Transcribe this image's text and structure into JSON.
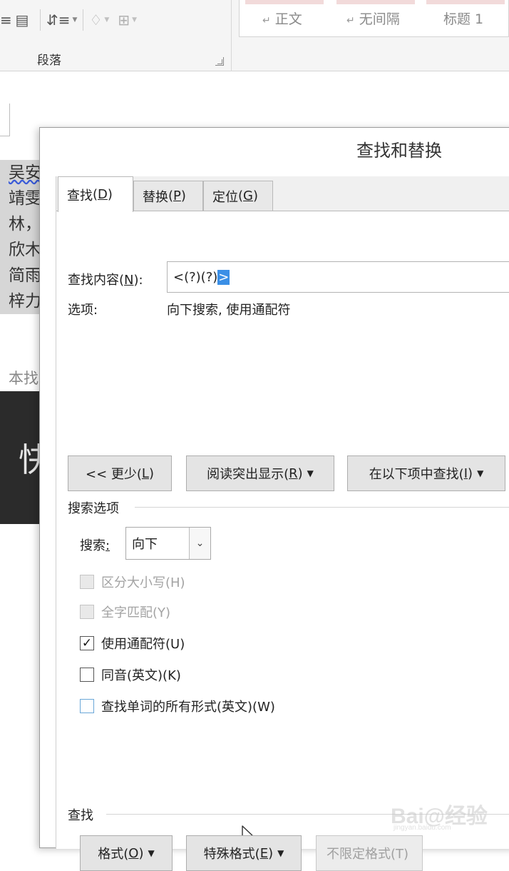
{
  "ribbon": {
    "paragraph_group_label": "段落",
    "styles": [
      "正文",
      "无间隔",
      "标题 1"
    ]
  },
  "document": {
    "lines": [
      "吴安",
      "靖雯",
      "林，",
      "欣木",
      "简雨",
      "梓力"
    ],
    "note": "本找",
    "dark_text": "快"
  },
  "dialog": {
    "title": "查找和替换",
    "tabs": [
      {
        "label": "查找",
        "accel": "D"
      },
      {
        "label": "替换",
        "accel": "P"
      },
      {
        "label": "定位",
        "accel": "G"
      }
    ],
    "find": {
      "label": "查找内容",
      "label_accel": "N",
      "value_prefix": "<(?)(?)",
      "value_selected": ">"
    },
    "options": {
      "label": "选项:",
      "value": "向下搜索, 使用通配符"
    },
    "buttons": {
      "less": {
        "prefix": "<< 更少(",
        "accel": "L",
        "suffix": ")"
      },
      "reading_highlight": {
        "prefix": "阅读突出显示(",
        "accel": "R",
        "suffix": ")"
      },
      "find_in": {
        "prefix": "在以下项中查找(",
        "accel": "I",
        "suffix": ")"
      }
    },
    "search_options": {
      "section_label": "搜索选项",
      "search_label": "搜索",
      "search_accel": ":",
      "search_value": "向下",
      "checkboxes": [
        {
          "label": "区分大小写(H)",
          "checked": false,
          "disabled": true
        },
        {
          "label": "全字匹配(Y)",
          "checked": false,
          "disabled": true
        },
        {
          "label": "使用通配符(U)",
          "checked": true,
          "disabled": false
        },
        {
          "label": "同音(英文)(K)",
          "checked": false,
          "disabled": false
        },
        {
          "label": "查找单词的所有形式(英文)(W)",
          "checked": false,
          "disabled": false
        }
      ]
    },
    "find_section": {
      "section_label": "查找",
      "format": {
        "prefix": "格式(",
        "accel": "O",
        "suffix": ")"
      },
      "special": {
        "prefix": "特殊格式(",
        "accel": "E",
        "suffix": ")"
      },
      "no_format": "不限定格式(T)"
    }
  },
  "watermark": {
    "text": "Bai@经验",
    "sub": "jingyan.baidu.com"
  }
}
